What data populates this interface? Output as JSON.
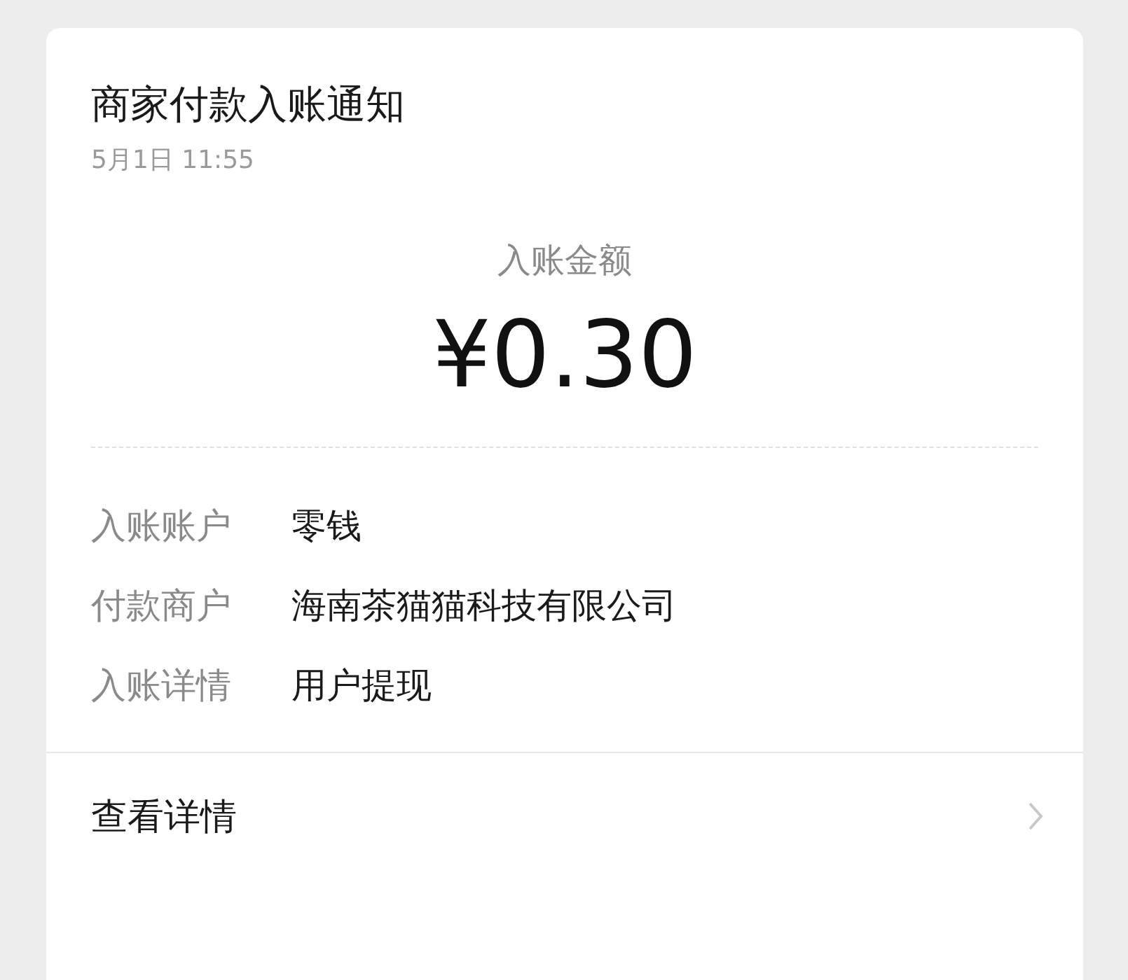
{
  "card": {
    "title": "商家付款入账通知",
    "time": "5月1日  11:55",
    "amount_label": "入账金额",
    "amount": "¥0.30",
    "rows": [
      {
        "label": "入账账户",
        "value": "零钱"
      },
      {
        "label": "付款商户",
        "value": "海南茶猫猫科技有限公司"
      },
      {
        "label": "入账详情",
        "value": "用户提现"
      }
    ],
    "footer_link": "查看详情"
  }
}
